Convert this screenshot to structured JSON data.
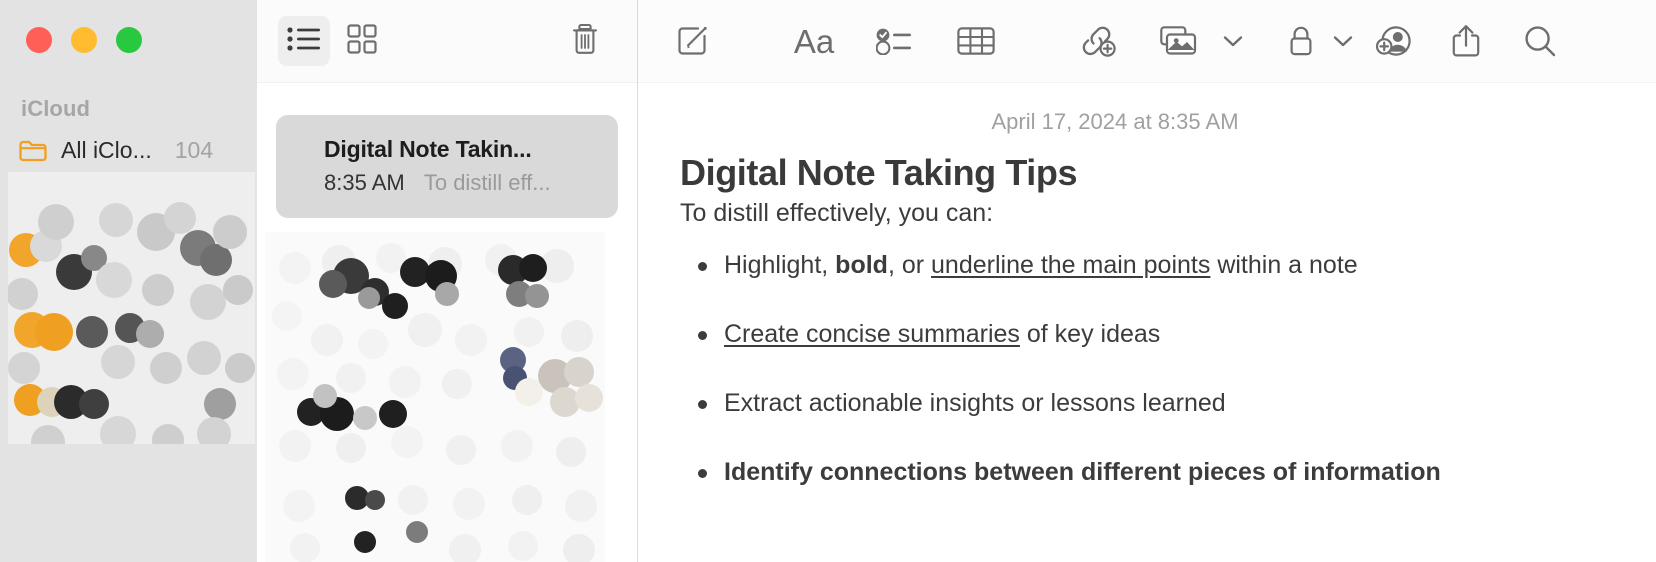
{
  "window": {
    "traffic_lights": [
      {
        "name": "close",
        "color": "#ff5f57"
      },
      {
        "name": "minimize",
        "color": "#febc2e"
      },
      {
        "name": "maximize",
        "color": "#28c840"
      }
    ]
  },
  "sidebar": {
    "section_title": "iCloud",
    "folder": {
      "icon": "folder-icon",
      "name": "All iClo...",
      "count": "104",
      "accent_color": "#f0a020"
    }
  },
  "notelist": {
    "toolbar": [
      {
        "name": "list-view-icon",
        "label": "List View",
        "active": true
      },
      {
        "name": "gallery-view-icon",
        "label": "Gallery View",
        "active": false
      },
      {
        "name": "trash-icon",
        "label": "Delete",
        "active": false
      }
    ],
    "selected_note": {
      "title": "Digital Note Takin...",
      "time": "8:35 AM",
      "preview": "To distill eff..."
    }
  },
  "editor": {
    "toolbar": [
      {
        "name": "compose-icon",
        "label": "New Note"
      },
      {
        "name": "format-icon",
        "label": "Aa"
      },
      {
        "name": "checklist-icon",
        "label": "Checklist"
      },
      {
        "name": "table-icon",
        "label": "Table"
      },
      {
        "name": "add-link-icon",
        "label": "Add Link"
      },
      {
        "name": "media-icon",
        "label": "Media"
      },
      {
        "name": "media-chevron-icon",
        "label": "Media Options"
      },
      {
        "name": "lock-icon",
        "label": "Lock Note"
      },
      {
        "name": "lock-chevron-icon",
        "label": "Lock Options"
      },
      {
        "name": "add-collaborator-icon",
        "label": "Add People"
      },
      {
        "name": "share-icon",
        "label": "Share"
      },
      {
        "name": "search-icon",
        "label": "Search"
      }
    ],
    "document": {
      "date": "April 17, 2024 at 8:35 AM",
      "title": "Digital Note Taking Tips",
      "lede": "To distill effectively, you can:",
      "bullets": [
        {
          "bold_all": false,
          "segments": [
            {
              "text": "Highlight, ",
              "style": "normal"
            },
            {
              "text": "bold",
              "style": "bold"
            },
            {
              "text": ", or ",
              "style": "normal"
            },
            {
              "text": "underline the main points",
              "style": "underline"
            },
            {
              "text": " within a note",
              "style": "normal"
            }
          ]
        },
        {
          "bold_all": false,
          "segments": [
            {
              "text": "Create concise summaries",
              "style": "underline"
            },
            {
              "text": " of key ideas",
              "style": "normal"
            }
          ]
        },
        {
          "bold_all": false,
          "segments": [
            {
              "text": "Extract actionable insights or lessons learned",
              "style": "normal"
            }
          ]
        },
        {
          "bold_all": true,
          "segments": [
            {
              "text": "Identify connections between different pieces of information",
              "style": "normal"
            }
          ]
        }
      ]
    }
  }
}
